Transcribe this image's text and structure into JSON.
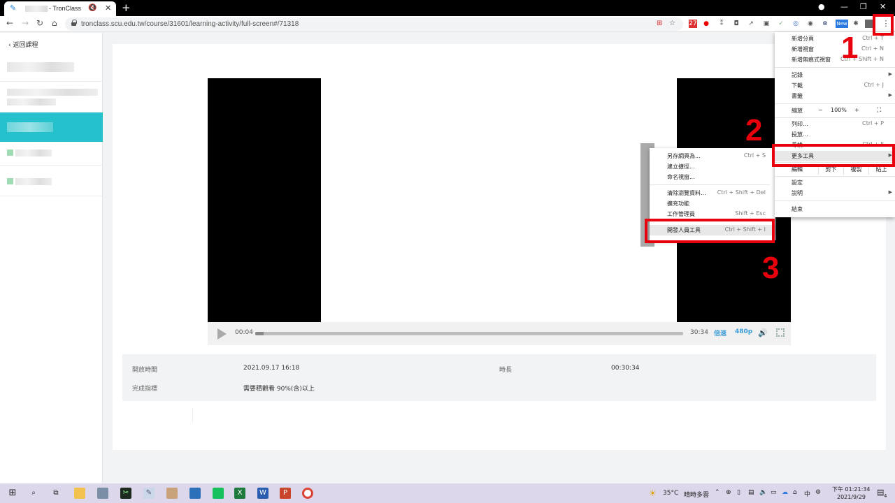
{
  "browser": {
    "tab_title": "- TronClass",
    "url": "tronclass.scu.edu.tw/course/31601/learning-activity/full-screen#/71318",
    "ext_new_badge": "New",
    "ext_mail_count": "27"
  },
  "sidebar": {
    "back_label": "返回課程"
  },
  "player": {
    "current_time": "00:04",
    "duration": "30:34",
    "progress_fraction": 0.003,
    "speed_label": "倍速",
    "quality_label": "480p"
  },
  "info": {
    "open_time_label": "開放時間",
    "open_time_value": "2021.09.17 16:18",
    "duration_label": "時長",
    "duration_value": "00:30:34",
    "completion_label": "完成指標",
    "completion_value": "需要積觀看 90%(含)以上"
  },
  "chrome_menu": {
    "new_tab": "新增分頁",
    "new_tab_key": "Ctrl + T",
    "new_window": "新增視窗",
    "new_window_key": "Ctrl + N",
    "incognito": "新增無痕式視窗",
    "incognito_key": "Ctrl + Shift + N",
    "history": "記錄",
    "downloads": "下載",
    "downloads_key": "Ctrl + J",
    "bookmarks": "書籤",
    "zoom_label": "縮放",
    "zoom_minus": "−",
    "zoom_value": "100%",
    "zoom_plus": "+",
    "print": "列印...",
    "print_key": "Ctrl + P",
    "cast": "投放...",
    "find": "尋找...",
    "find_key": "Ctrl + F",
    "more_tools": "更多工具",
    "edit_label": "編輯",
    "cut": "剪下",
    "copy": "複製",
    "paste": "貼上",
    "settings": "設定",
    "help": "說明",
    "exit": "結束"
  },
  "more_tools_menu": {
    "save_page": "另存網頁為...",
    "save_page_key": "Ctrl + S",
    "create_shortcut": "建立捷徑...",
    "name_window": "命名視窗...",
    "clear_data": "清除瀏覽資料...",
    "clear_data_key": "Ctrl + Shift + Del",
    "extensions": "擴充功能",
    "task_manager": "工作管理員",
    "task_manager_key": "Shift + Esc",
    "dev_tools": "開發人員工具",
    "dev_tools_key": "Ctrl + Shift + I"
  },
  "annotations": {
    "step1": "1",
    "step2": "2",
    "step3": "3"
  },
  "taskbar": {
    "temperature": "35°C",
    "weather": "晴時多雲",
    "ime": "中",
    "time": "下午 01:21:34",
    "date": "2021/9/29",
    "notif_count": "4"
  },
  "colors": {
    "accent": "#25c1cc",
    "annotation": "#e8000d",
    "player_accent": "#3a9bd6"
  }
}
